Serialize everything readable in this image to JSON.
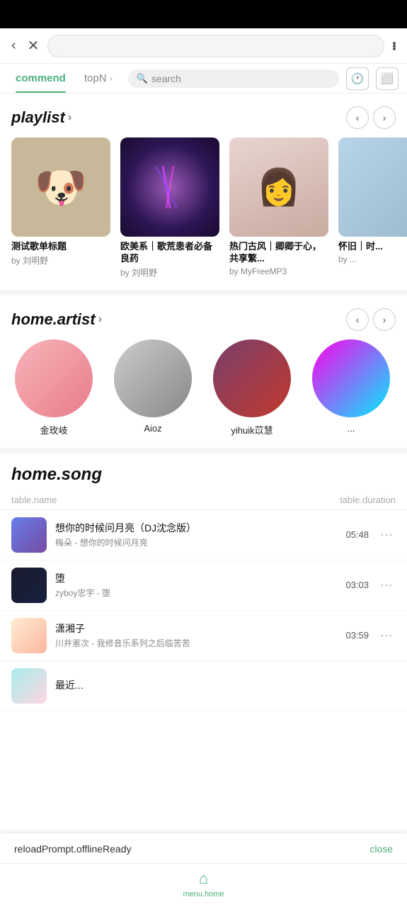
{
  "statusBar": {},
  "browserBar": {
    "backLabel": "‹",
    "closeLabel": "✕"
  },
  "tabs": {
    "items": [
      {
        "id": "commend",
        "label": "commend",
        "active": true
      },
      {
        "id": "topN",
        "label": "topN",
        "active": false
      }
    ],
    "searchPlaceholder": "search"
  },
  "playlist": {
    "title": "playlist",
    "chevron": "›",
    "items": [
      {
        "id": 1,
        "name": "测试歌单标题",
        "by": "by 刘明野"
      },
      {
        "id": 2,
        "name": "欧美系｜歌荒患者必备良药",
        "by": "by 刘明野"
      },
      {
        "id": 3,
        "name": "热门古风｜卿卿于心，共享繁...",
        "by": "by MyFreeMP3"
      },
      {
        "id": 4,
        "name": "怀旧｜时...",
        "by": "by ..."
      }
    ]
  },
  "artist": {
    "title": "home.artist",
    "chevron": "›",
    "items": [
      {
        "id": 1,
        "name": "金玫岐"
      },
      {
        "id": 2,
        "name": "Aioz"
      },
      {
        "id": 3,
        "name": "yihuik苡慧"
      },
      {
        "id": 4,
        "name": "..."
      }
    ]
  },
  "songs": {
    "title": "home.song",
    "tableNameHeader": "table.name",
    "tableDurationHeader": "table.duration",
    "items": [
      {
        "id": 1,
        "name": "想你的时候问月亮（DJ沈念版）",
        "artist": "梅朵 - 想你的时候问月亮",
        "duration": "05:48"
      },
      {
        "id": 2,
        "name": "堕",
        "artist": "zyboy忠宇 - 堕",
        "duration": "03:03"
      },
      {
        "id": 3,
        "name": "潇湘子",
        "artist": "川井憲次 - 我修音乐系列之后临苦苦",
        "duration": "03:59"
      },
      {
        "id": 4,
        "name": "最近...",
        "artist": "",
        "duration": ""
      }
    ]
  },
  "offlineBar": {
    "message": "reloadPrompt.offlineReady",
    "closeLabel": "close"
  },
  "bottomNav": {
    "homeLabel": "menu.home",
    "homeIcon": "⌂"
  }
}
